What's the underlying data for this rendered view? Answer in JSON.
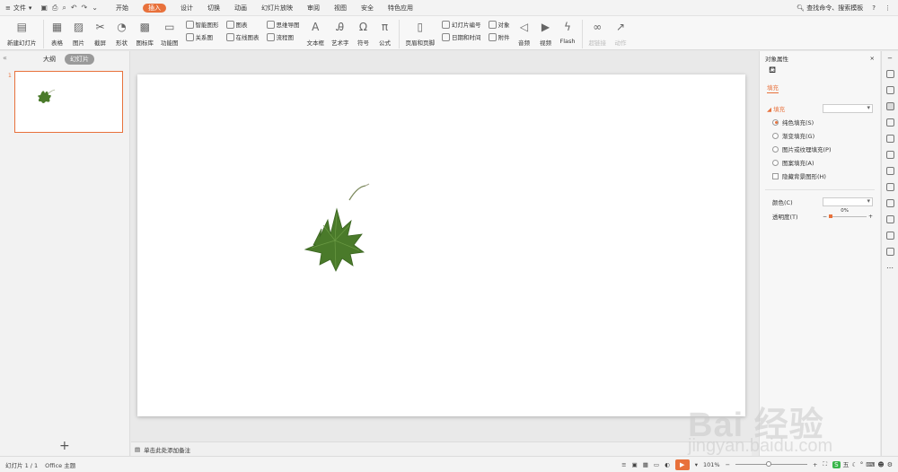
{
  "topbar": {
    "file_label": "文件",
    "tabs": [
      "开始",
      "插入",
      "设计",
      "切换",
      "动画",
      "幻灯片放映",
      "审阅",
      "视图",
      "安全",
      "特色应用"
    ],
    "active_tab": "插入",
    "search_label": "查找命令、搜索模板",
    "help": "?",
    "more": "⋮"
  },
  "ribbon": {
    "new_slide": "新建幻灯片",
    "table": "表格",
    "picture": "图片",
    "screenshot": "截屏",
    "shape": "形状",
    "gallery": "图标库",
    "function_chart": "功能图",
    "smart_art": "智能图形",
    "relation_chart": "关系图",
    "chart": "图表",
    "online_chart": "在线图表",
    "mind_map": "思维导图",
    "flow_chart": "流程图",
    "text_box": "文本框",
    "art_text": "艺术字",
    "symbol": "符号",
    "formula": "公式",
    "header_footer": "页眉和页脚",
    "slide_number": "幻灯片编号",
    "date_time": "日期和时间",
    "object": "对象",
    "attachment": "附件",
    "audio": "音频",
    "video": "视频",
    "flash": "Flash",
    "hyperlink": "超链接",
    "action": "动作"
  },
  "left_panel": {
    "tab_outline": "大纲",
    "tab_slides": "幻灯片",
    "slide_number": "1",
    "add": "+"
  },
  "notes": {
    "placeholder": "单击此处添加备注"
  },
  "right_panel": {
    "title": "对象属性",
    "fill_tab": "填充",
    "fill_section": "填充",
    "options": [
      "纯色填充(S)",
      "渐变填充(G)",
      "图片或纹理填充(P)",
      "图案填充(A)"
    ],
    "selected_option": 0,
    "hide_bg": "隐藏背景图形(H)",
    "color_label": "颜色(C)",
    "transparency_label": "透明度(T)",
    "transparency_value": "0%",
    "minus": "−",
    "plus": "+"
  },
  "statusbar": {
    "slide_info": "幻灯片 1 / 1",
    "theme": "Office 主题",
    "zoom": "101%",
    "ime_label": "五"
  },
  "watermark": {
    "brand": "Bai 经验",
    "url": "jingyan.baidu.com"
  },
  "colors": {
    "accent": "#e8713b",
    "leaf": "#4a7a2a"
  }
}
